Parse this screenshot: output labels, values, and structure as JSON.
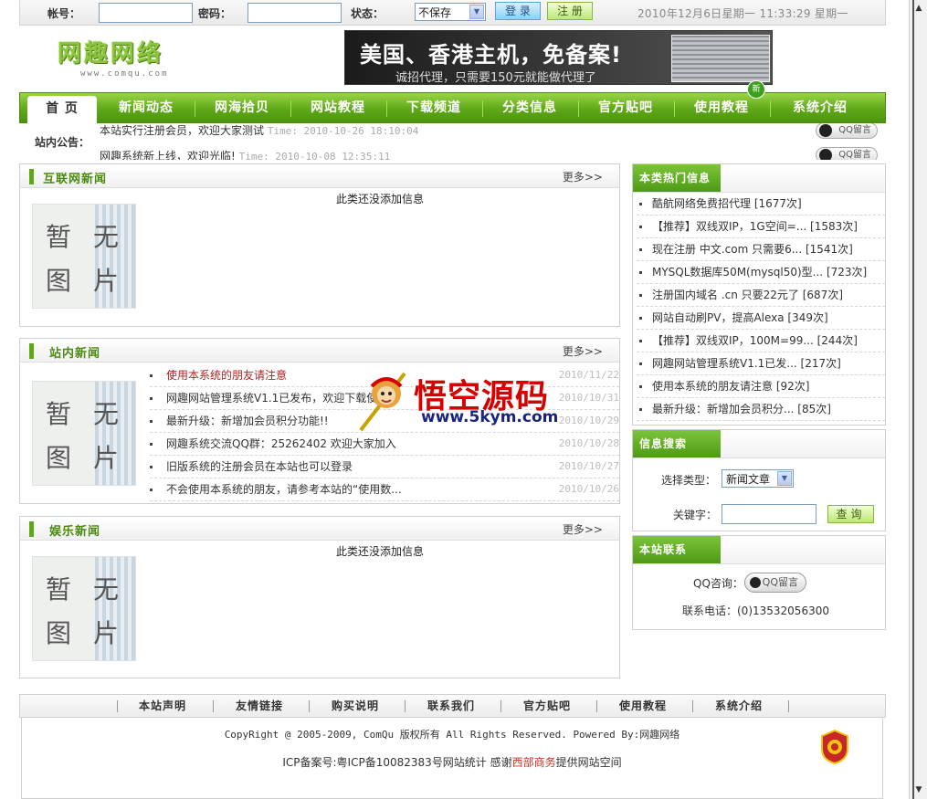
{
  "login": {
    "account_label": "帐号：",
    "password_label": "密码：",
    "status_label": "状态：",
    "status_value": "不保存",
    "login_btn": "登 录",
    "register_btn": "注 册",
    "datetime": "2010年12月6日星期一 11:33:29 星期一"
  },
  "header": {
    "logo_text": "网趣网络",
    "logo_sub": "www.comqu.com",
    "banner_line1": "美国、香港主机，免备案!",
    "banner_line2": "诚招代理，只需要150元就能做代理了"
  },
  "nav": {
    "items": [
      "首 页",
      "新闻动态",
      "网海拾贝",
      "网站教程",
      "下载频道",
      "分类信息",
      "官方贴吧",
      "使用教程",
      "系统介绍"
    ],
    "new_badge": "新"
  },
  "notice": {
    "label": "站内公告：",
    "line1": "本站实行注册会员，欢迎大家测试",
    "line1_time": "Time: 2010-10-26 18:10:04",
    "line2": "网趣系统新上线，欢迎光临!",
    "line2_time": "Time: 2010-10-08 12:35:11",
    "qq_label": "QQ留言"
  },
  "panels": {
    "internet_news": {
      "title": "互联网新闻",
      "more": "更多>>",
      "empty": "此类还没添加信息"
    },
    "site_news": {
      "title": "站内新闻",
      "more": "更多>>",
      "rows": [
        {
          "title": "使用本系统的朋友请注意",
          "date": "2010/11/22",
          "hot": true
        },
        {
          "title": "网趣网站管理系统V1.1已发布，欢迎下载使用",
          "date": "2010/10/31",
          "hot": false
        },
        {
          "title": "最新升级：新增加会员积分功能!!",
          "date": "2010/10/29",
          "hot": false
        },
        {
          "title": "网趣系统交流QQ群：25262402 欢迎大家加入",
          "date": "2010/10/28",
          "hot": false
        },
        {
          "title": "旧版系统的注册会员在本站也可以登录",
          "date": "2010/10/27",
          "hot": false
        },
        {
          "title": "不会使用本系统的朋友，请参考本站的“使用数...",
          "date": "2010/10/26",
          "hot": false
        }
      ]
    },
    "ent_news": {
      "title": "娱乐新闻",
      "more": "更多>>",
      "empty": "此类还没添加信息"
    },
    "noimg_chars": [
      "暂",
      "无",
      "图",
      "片"
    ]
  },
  "hot_info": {
    "title": "本类热门信息",
    "rows": [
      "酷航网络免费招代理 [1677次]",
      "【推荐】双线双IP，1G空间=... [1583次]",
      "现在注册 中文.com 只需要6... [1541次]",
      "MYSQL数据库50M(mysql50)型... [723次]",
      "注册国内域名 .cn 只要22元了 [687次]",
      "网站自动刷PV，提高Alexa [349次]",
      "【推荐】双线双IP，100M=99... [244次]",
      "网趣网站管理系统V1.1已发... [217次]",
      "使用本系统的朋友请注意 [92次]",
      "最新升级：新增加会员积分... [85次]"
    ]
  },
  "search": {
    "title": "信息搜索",
    "type_label": "选择类型：",
    "type_value": "新闻文章",
    "keyword_label": "关键字：",
    "query_btn": "查询"
  },
  "contact": {
    "title": "本站联系",
    "qq_label": "QQ咨询：",
    "qq_btn": "QQ留言",
    "phone": "联系电话：(0)13532056300"
  },
  "footer": {
    "links": [
      "本站声明",
      "友情链接",
      "购买说明",
      "联系我们",
      "官方贴吧",
      "使用教程",
      "系统介绍"
    ],
    "copyright": "CopyRight @ 2005-2009, ComQu 版权所有 All Rights Reserved. Powered By:网趣网络",
    "icp_prefix": "ICP备案号:粤ICP备10082383号网站统计   感谢",
    "icp_link": "西部商务",
    "icp_suffix": "提供网站空间"
  },
  "watermark": {
    "title": "悟空源码",
    "url": "www.5kym.com"
  },
  "colors": {
    "nav_green": "#5ea818",
    "title_green": "#4b8a12",
    "hot_red": "#b22222"
  }
}
